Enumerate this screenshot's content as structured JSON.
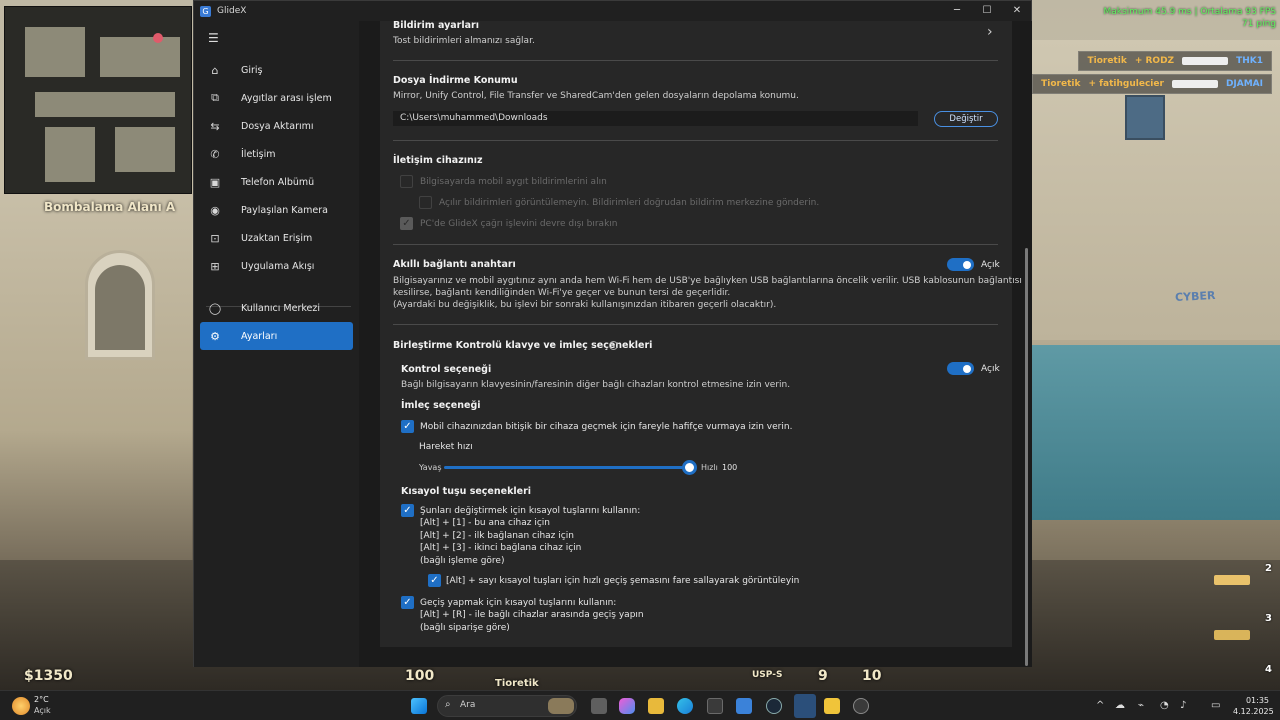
{
  "game": {
    "bombsite": "Bombalama Alanı A",
    "fps_line1": "Maksimum 45.9 ms | Ortalama 93 FPS",
    "fps_line2": "71 ping",
    "killfeed": [
      {
        "attacker": "Tioretik",
        "assist": "+ RODZ",
        "victim": "THK1"
      },
      {
        "attacker": "Tioretik",
        "assist": "+ fatihgulecier",
        "victim": "DJAMAI"
      }
    ],
    "slots": [
      "2",
      "3",
      "4"
    ],
    "hud_bottom": {
      "money": "$1350",
      "health": "100",
      "armor": "100",
      "player_name": "Tioretik",
      "weapon": "USP-S",
      "ammo_clip": "9",
      "ammo_reserve": "10"
    }
  },
  "window": {
    "title": "GlideX",
    "icon_label": "G",
    "controls": {
      "minimize": "─",
      "maximize": "☐",
      "close": "✕"
    }
  },
  "sidebar": {
    "menu_icon": "☰",
    "items": [
      {
        "label": "Giriş",
        "icon": "home-icon",
        "glyph": "⌂"
      },
      {
        "label": "Aygıtlar arası işlem",
        "icon": "cross-device-icon",
        "glyph": "⧉"
      },
      {
        "label": "Dosya Aktarımı",
        "icon": "file-transfer-icon",
        "glyph": "⇆"
      },
      {
        "label": "İletişim",
        "icon": "phone-icon",
        "glyph": "✆"
      },
      {
        "label": "Telefon Albümü",
        "icon": "photo-album-icon",
        "glyph": "▣"
      },
      {
        "label": "Paylaşılan Kamera",
        "icon": "camera-icon",
        "glyph": "◉"
      },
      {
        "label": "Uzaktan Erişim",
        "icon": "remote-access-icon",
        "glyph": "⊡"
      },
      {
        "label": "Uygulama Akışı",
        "icon": "app-stream-icon",
        "glyph": "⊞"
      },
      {
        "label": "Kullanıcı Merkezi",
        "icon": "user-icon",
        "glyph": "◯"
      },
      {
        "label": "Ayarları",
        "icon": "settings-icon",
        "glyph": "⚙"
      }
    ]
  },
  "settings": {
    "notifications": {
      "title": "Bildirim ayarları",
      "desc": "Tost bildirimleri almanızı sağlar.",
      "chevron": "›"
    },
    "download_location": {
      "title": "Dosya İndirme Konumu",
      "desc": "Mirror, Unify Control, File Transfer ve SharedCam'den gelen dosyaların depolama konumu.",
      "path": "C:\\Users\\muhammed\\Downloads",
      "change_button": "Değiştir"
    },
    "comm_device": {
      "title": "İletişim cihazınız",
      "option1": "Bilgisayarda mobil aygıt bildirimlerini alın",
      "option2": "Açılır bildirimleri görüntülemeyin. Bildirimleri doğrudan bildirim merkezine gönderin.",
      "option3": "PC'de GlideX çağrı işlevini devre dışı bırakın"
    },
    "smart_switch": {
      "title": "Akıllı bağlantı anahtarı",
      "toggle_label": "Açık",
      "desc1": "Bilgisayarınız ve mobil aygıtınız aynı anda hem Wi-Fi hem de USB'ye bağlıyken USB bağlantılarına öncelik verilir. USB kablosunun bağlantısı",
      "desc2": "kesilirse, bağlantı kendiliğinden Wi-Fi'ye geçer ve bunun tersi de geçerlidir.",
      "desc3": "(Ayardaki bu değişiklik, bu işlevi bir sonraki kullanışınızdan itibaren geçerli olacaktır)."
    },
    "unify": {
      "title": "Birleştirme Kontrolü klavye ve imleç seçenekleri",
      "info_icon": "?",
      "control_title": "Kontrol seçeneği",
      "control_toggle": "Açık",
      "control_desc": "Bağlı bilgisayarın klavyesinin/faresinin diğer bağlı cihazları kontrol etmesine izin verin.",
      "cursor_title": "İmleç seçeneği",
      "cursor_option": "Mobil cihazınızdan bitişik bir cihaza geçmek için fareyle hafifçe vurmaya izin verin.",
      "speed_label": "Hareket hızı",
      "slow": "Yavaş",
      "fast": "Hızlı",
      "speed_value": "100",
      "speed_fraction": 1.0,
      "shortcut_title": "Kısayol tuşu seçenekleri",
      "shortcut1_lines": [
        "Şunları değiştirmek için kısayol tuşlarını kullanın:",
        "[Alt] + [1] - bu ana cihaz için",
        "[Alt] + [2] - ilk bağlanan cihaz için",
        "[Alt] + [3] - ikinci bağlana cihaz için",
        "(bağlı işleme göre)"
      ],
      "shortcut_sub": "[Alt] + sayı kısayol tuşları için hızlı geçiş şemasını fare sallayarak görüntüleyin",
      "shortcut2_lines": [
        "Geçiş yapmak için kısayol tuşlarını kullanın:",
        "[Alt] + [R] - ile bağlı cihazlar arasında geçiş yapın",
        "(bağlı siparişe göre)"
      ],
      "check": "✓"
    }
  },
  "taskbar": {
    "weather_temp": "2°C",
    "weather_cond": "Açık",
    "search_placeholder": "Ara",
    "search_glyph": "⌕",
    "time": "01:35",
    "date": "4.12.2025",
    "tray_glyphs": [
      "^",
      "☁",
      "⌁",
      "◔",
      "♪",
      "▭"
    ]
  }
}
